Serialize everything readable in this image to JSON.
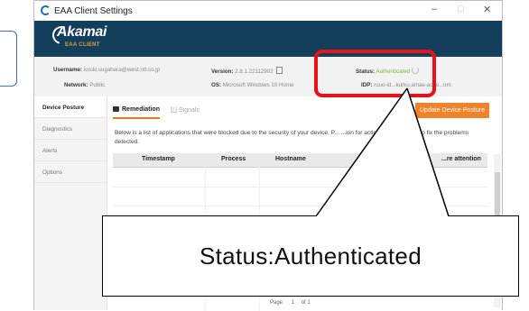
{
  "window": {
    "title": "EAA Client Settings",
    "minimize_glyph": "–",
    "maximize_glyph": "□",
    "close_glyph": "✕"
  },
  "brand": {
    "logo_text": "Akamai",
    "logo_sub": "EAA CLIENT"
  },
  "info": {
    "username_label": "Username:",
    "username_value": "kouki.sugahara@west.ntt.co.jp",
    "network_label": "Network:",
    "network_value": "Public",
    "version_label": "Version:",
    "version_value": "2.8.1.22112902",
    "os_label": "OS:",
    "os_value": "Microsoft Windows 10 Home",
    "status_label": "Status:",
    "status_value": "Authenticated",
    "idp_label": "IDP:",
    "idp_value": "ruuo-id...kurku.amae-acce...om"
  },
  "sidebar": {
    "items": [
      {
        "label": "Device Posture"
      },
      {
        "label": "Diagnostics"
      },
      {
        "label": "Alerts"
      },
      {
        "label": "Options"
      }
    ]
  },
  "main": {
    "tab_remediation": "Remediation",
    "tab_signals": "Signals",
    "update_button": "Update Device Posture",
    "description": "Below is a list of applications that were blocked due to the security of your device. P... ...ion for actions you can take to fix the problems detected.",
    "columns": [
      "Timestamp",
      "Process",
      "Hostname",
      "...re attention"
    ],
    "pager_label": "Page",
    "pager_value": "1",
    "pager_of": "of 1"
  },
  "callout": {
    "text": "Status:Authenticated"
  },
  "colors": {
    "header_bg": "#133f5c",
    "accent_orange": "#f0832a",
    "highlight_red": "#e8121a",
    "status_green": "#7ab648"
  }
}
